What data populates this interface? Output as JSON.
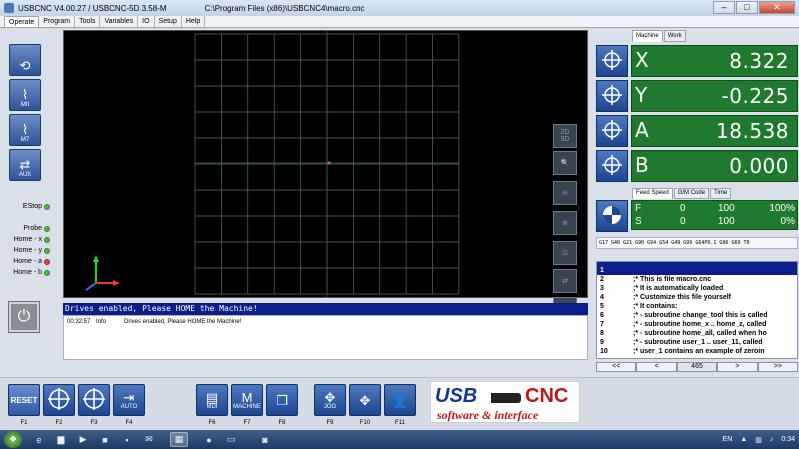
{
  "window": {
    "title": "USBCNC V4.00.27 / USBCNC-5D 3.58-M",
    "path": "C:\\Program Files (x86)\\USBCNC4\\macro.cnc",
    "minimize": "–",
    "maximize": "□",
    "close": "✕"
  },
  "tabs": [
    "Operate",
    "Program",
    "Tools",
    "Variables",
    "IO",
    "Setup",
    "Help"
  ],
  "left_buttons": [
    {
      "label": "",
      "icon": "spindle-icon",
      "glyph": "⟲"
    },
    {
      "label": "MII",
      "icon": "flood-icon",
      "glyph": "⌇"
    },
    {
      "label": "M7",
      "icon": "mist-icon",
      "glyph": "⌇"
    },
    {
      "label": "AUX",
      "icon": "aux-icon",
      "glyph": "⇄"
    }
  ],
  "indicators": [
    {
      "label": "EStop",
      "state": "green"
    },
    {
      "label": "Probe",
      "state": "green"
    },
    {
      "label": "Home - x",
      "state": "green"
    },
    {
      "label": "Home - y",
      "state": "green"
    },
    {
      "label": "Home - a",
      "state": "red"
    },
    {
      "label": "Home - b",
      "state": "green"
    }
  ],
  "view_tools": [
    {
      "label": "2D\n3D",
      "icon": "view-toggle-icon"
    },
    {
      "label": "",
      "icon": "zoom-fit-icon"
    },
    {
      "label": "",
      "icon": "zoom-out-icon"
    },
    {
      "label": "",
      "icon": "zoom-in-icon"
    },
    {
      "label": "",
      "icon": "zoom-window-icon"
    },
    {
      "label": "",
      "icon": "clear-view-icon"
    },
    {
      "label": "",
      "icon": "save-view-icon"
    }
  ],
  "message_bar": "Drives enabled, Please HOME the Machine!",
  "log": [
    {
      "time": "00:32:57",
      "level": "Info",
      "text": "Drives enabled, Please HOME the Machine!"
    }
  ],
  "position_tabs": [
    "Machine",
    "Work"
  ],
  "axes": [
    {
      "name": "X",
      "value": "8.322"
    },
    {
      "name": "Y",
      "value": "-0.225"
    },
    {
      "name": "A",
      "value": "18.538"
    },
    {
      "name": "B",
      "value": "0.000"
    }
  ],
  "feed_tabs": [
    "Feed Speed",
    "G/M Code",
    "Time"
  ],
  "feed": {
    "label": "F",
    "value": "0",
    "max": "100",
    "pct": "100%"
  },
  "speed": {
    "label": "S",
    "value": "0",
    "max": "100",
    "pct": "0%"
  },
  "gm_codes": "G17 G40 G21 G90 G94 G54 G49 G99 G64P0.1 G96 G69 T0",
  "code_lines": [
    {
      "n": "1",
      "text": ""
    },
    {
      "n": "2",
      "text": ";* This is file macro.cnc"
    },
    {
      "n": "3",
      "text": ";* It is automatically loaded"
    },
    {
      "n": "4",
      "text": ";* Customize this file yourself"
    },
    {
      "n": "5",
      "text": ";* It contains:"
    },
    {
      "n": "6",
      "text": ";* - subroutine change_tool this is called"
    },
    {
      "n": "7",
      "text": ";* - subroutine home_x .. home_z, called"
    },
    {
      "n": "8",
      "text": ";* - subroutine home_all, called when ho"
    },
    {
      "n": "9",
      "text": ";* - subroutine user_1 .. user_11, called"
    },
    {
      "n": "10",
      "text": ";*  user_1 contains an example of zeroin"
    }
  ],
  "code_nav": {
    "first": "<<",
    "prev": "<",
    "page": "465",
    "next": ">",
    "last": ">>"
  },
  "function_keys": [
    {
      "key": "F1",
      "label": "RESET",
      "icon": "reset-icon"
    },
    {
      "key": "F2",
      "label": "",
      "icon": "home-target-icon"
    },
    {
      "key": "F3",
      "label": "",
      "icon": "crosshair-icon"
    },
    {
      "key": "F4",
      "label": "AUTO",
      "icon": "auto-icon"
    },
    {
      "key": "F6",
      "label": "MDI",
      "icon": "mdi-icon"
    },
    {
      "key": "F7",
      "label": "MACHINE",
      "icon": "machine-icon"
    },
    {
      "key": "F8",
      "label": "",
      "icon": "files-icon"
    },
    {
      "key": "F9",
      "label": "JOG",
      "icon": "jog-icon"
    },
    {
      "key": "F10",
      "label": "",
      "icon": "jog-step-icon"
    },
    {
      "key": "F11",
      "label": "",
      "icon": "user-icon"
    }
  ],
  "logo": {
    "usb": "USB",
    "cnc": "CNC",
    "tagline": "software & interface"
  },
  "taskbar": {
    "lang": "EN",
    "time": "0:34"
  },
  "colors": {
    "axis_bg": "#1f7a2f",
    "message_bg": "#0c1e8a",
    "button_blue": "#2d5396"
  }
}
